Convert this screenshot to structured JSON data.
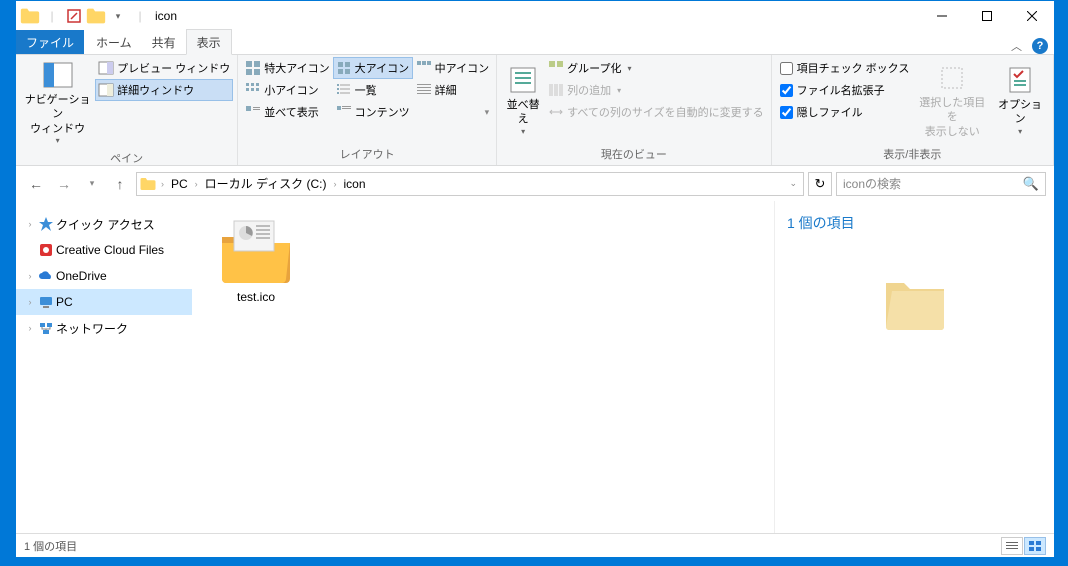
{
  "window": {
    "title": "icon"
  },
  "tabs": {
    "file": "ファイル",
    "home": "ホーム",
    "share": "共有",
    "view": "表示"
  },
  "ribbon": {
    "pain": {
      "nav": "ナビゲーション\nウィンドウ",
      "preview": "プレビュー ウィンドウ",
      "details": "詳細ウィンドウ",
      "label": "ペイン"
    },
    "layout": {
      "extra_large": "特大アイコン",
      "large": "大アイコン",
      "medium": "中アイコン",
      "small": "小アイコン",
      "list": "一覧",
      "details": "詳細",
      "tiles": "並べて表示",
      "content": "コンテンツ",
      "label": "レイアウト"
    },
    "current": {
      "sort": "並べ替え",
      "group": "グループ化",
      "add_col": "列の追加",
      "autosize": "すべての列のサイズを自動的に変更する",
      "label": "現在のビュー"
    },
    "show": {
      "checkboxes": "項目チェック ボックス",
      "extensions": "ファイル名拡張子",
      "hidden": "隠しファイル",
      "hide_selected": "選択した項目を\n表示しない",
      "options": "オプション",
      "label": "表示/非表示"
    }
  },
  "checks": {
    "checkboxes": false,
    "extensions": true,
    "hidden": true
  },
  "breadcrumb": {
    "pc": "PC",
    "drive": "ローカル ディスク (C:)",
    "folder": "icon"
  },
  "search": {
    "placeholder": "iconの検索"
  },
  "nav": {
    "quick": "クイック アクセス",
    "creative": "Creative Cloud Files",
    "onedrive": "OneDrive",
    "pc": "PC",
    "network": "ネットワーク"
  },
  "files": [
    {
      "name": "test.ico"
    }
  ],
  "preview": {
    "count": "1 個の項目"
  },
  "status": {
    "count": "1 個の項目"
  }
}
